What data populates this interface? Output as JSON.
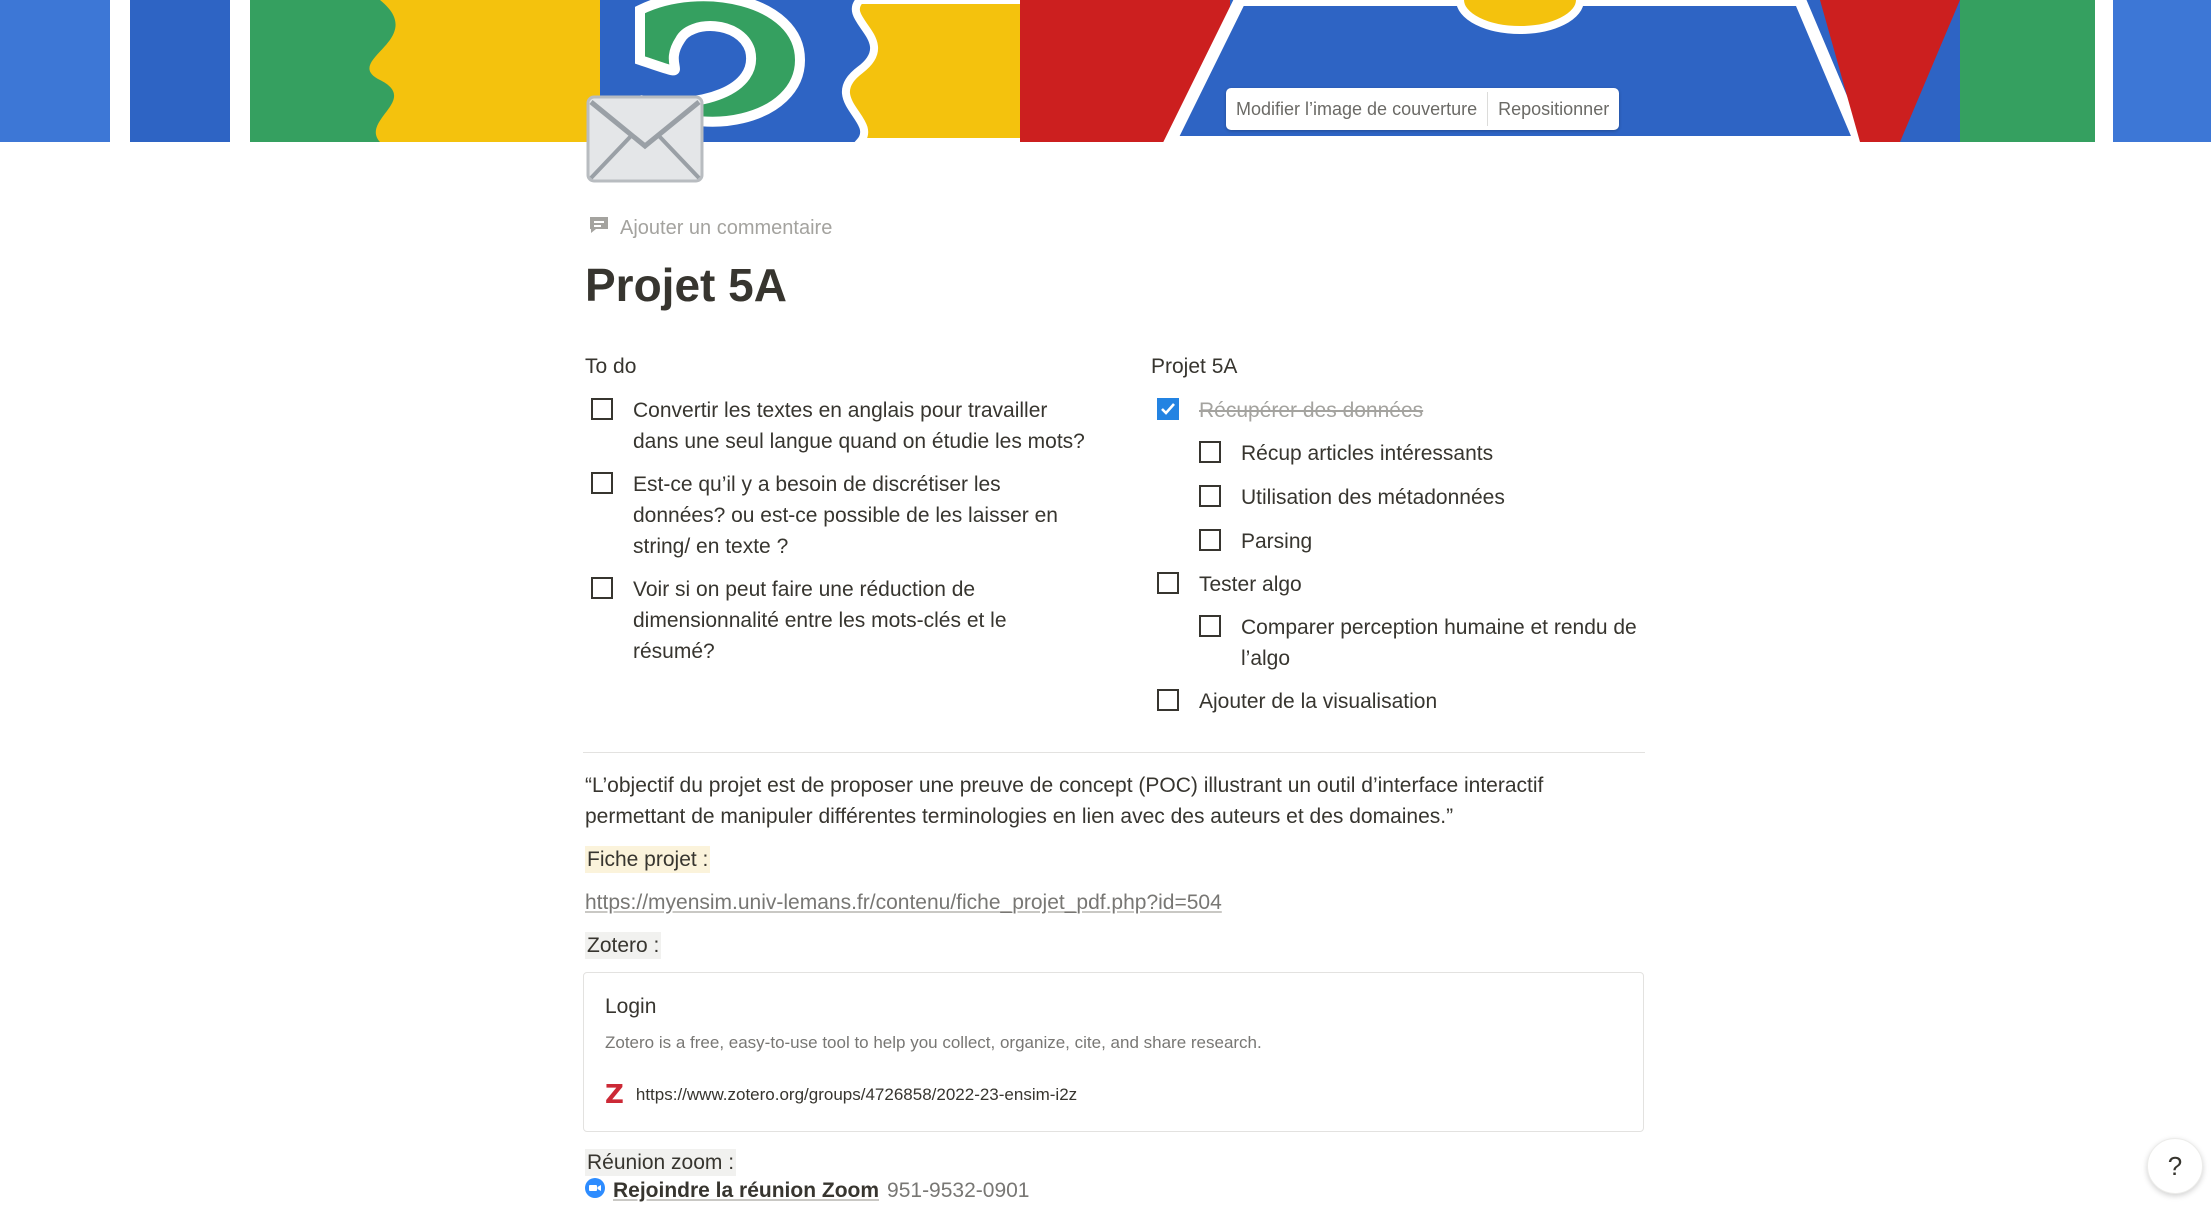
{
  "cover": {
    "change_label": "Modifier l’image de couverture",
    "reposition_label": "Repositionner"
  },
  "page": {
    "icon": "envelope-icon",
    "add_comment": "Ajouter un commentaire",
    "title": "Projet 5A"
  },
  "todo_column": {
    "heading": "To do",
    "items": [
      {
        "text": "Convertir les textes en anglais pour travailler dans une seul langue quand on étudie les mots?",
        "checked": false
      },
      {
        "text": "Est-ce qu’il y a besoin de discrétiser les données? ou est-ce possible de les laisser en string/ en texte ?",
        "checked": false
      },
      {
        "text": "Voir si on peut faire une réduction de dimensionnalité entre les mots-clés et le résumé?",
        "checked": false
      }
    ]
  },
  "project_column": {
    "heading": "Projet 5A",
    "items": [
      {
        "text": "Récupérer des données",
        "checked": true
      },
      {
        "text": "Récup articles intéressants",
        "checked": false
      },
      {
        "text": "Utilisation des métadonnées",
        "checked": false
      },
      {
        "text": "Parsing",
        "checked": false
      },
      {
        "text": "Tester algo",
        "checked": false
      },
      {
        "text": "Comparer perception humaine et rendu de l’algo",
        "checked": false
      },
      {
        "text": "Ajouter de la visualisation",
        "checked": false
      }
    ]
  },
  "quote": "“L’objectif du projet est de proposer une preuve de concept (POC) illustrant un outil d’interface interactif permettant de manipuler différentes terminologies en lien avec des auteurs et des domaines.”",
  "fiche_label": "Fiche projet :",
  "fiche_url": "https://myensim.univ-lemans.fr/contenu/fiche_projet_pdf.php?id=504",
  "zotero_label": "Zotero :",
  "bookmark": {
    "title": "Login",
    "description": "Zotero is a free, easy-to-use tool to help you collect, organize, cite, and share research.",
    "url": "https://www.zotero.org/groups/4726858/2022-23-ensim-i2z",
    "logo": "Z"
  },
  "zoom": {
    "label": "Réunion zoom :",
    "link": "Rejoindre la réunion Zoom",
    "id": "951-9532-0901"
  },
  "help_label": "?",
  "colors": {
    "accent": "#2383e2",
    "yellow_highlight": "#fbf3db",
    "gray_highlight": "#f1f1ef",
    "text": "#37352f"
  }
}
